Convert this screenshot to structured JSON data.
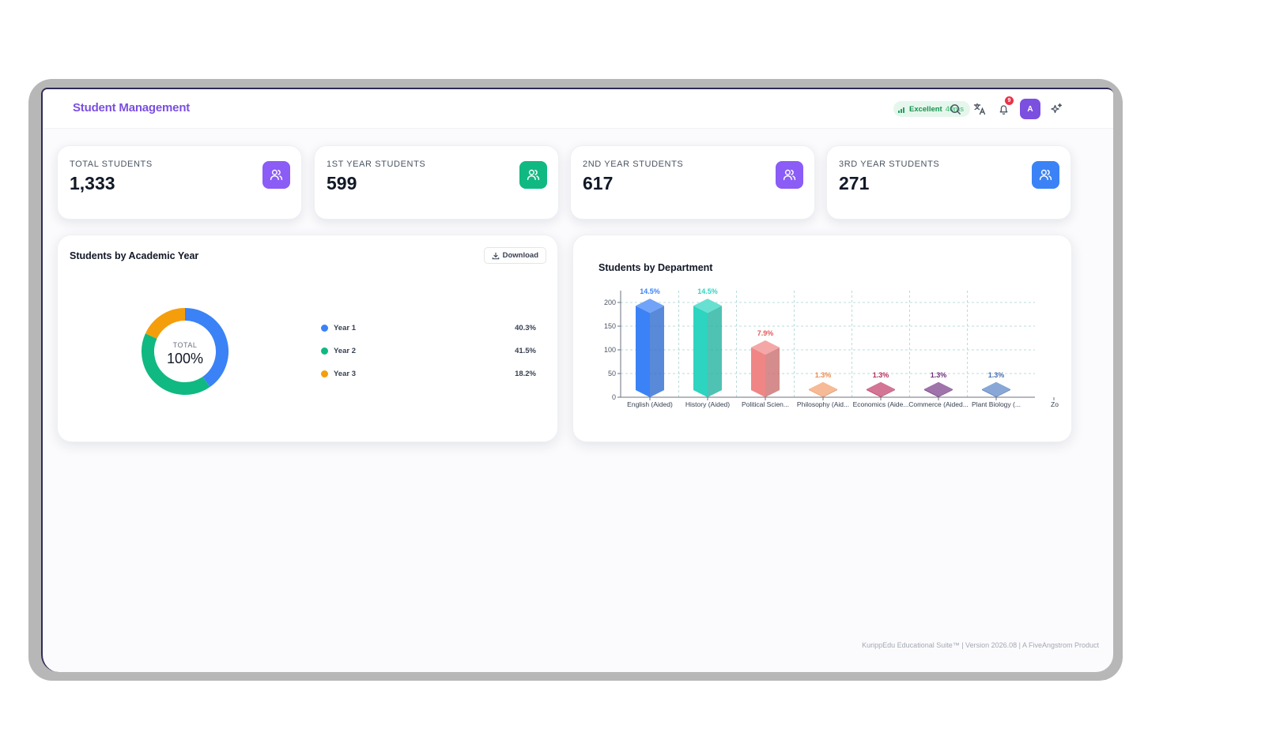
{
  "header": {
    "title": "Student Management",
    "status": {
      "quality": "Excellent",
      "latency": "40ms",
      "color": "#16924f"
    },
    "icons": [
      "search-icon",
      "translate-icon",
      "bell-icon",
      "sparkle-icon"
    ],
    "notification_count": "9",
    "avatar_initial": "A"
  },
  "stats": [
    {
      "label": "TOTAL STUDENTS",
      "value": "1,333",
      "icon": "users-icon",
      "color": "#8b5cf6"
    },
    {
      "label": "1ST YEAR STUDENTS",
      "value": "599",
      "icon": "users-icon",
      "color": "#10b981"
    },
    {
      "label": "2ND YEAR STUDENTS",
      "value": "617",
      "icon": "users-icon",
      "color": "#8b5cf6"
    },
    {
      "label": "3RD YEAR STUDENTS",
      "value": "271",
      "icon": "users-icon",
      "color": "#3b82f6"
    }
  ],
  "academic_panel": {
    "title": "Students by Academic Year",
    "download_label": "Download",
    "center_label": "TOTAL",
    "center_value": "100%"
  },
  "department_panel": {
    "title": "Students by Department"
  },
  "footer": {
    "text": "KurippEdu Educational Suite™ | Version 2026.08 | A FiveAngstrom Product"
  },
  "chart_data": [
    {
      "type": "pie",
      "categories": [
        "Year 1",
        "Year 2",
        "Year 3"
      ],
      "values": [
        40.3,
        41.5,
        18.2
      ],
      "value_labels": [
        "40.3%",
        "41.5%",
        "18.2%"
      ],
      "colors": [
        "#3b82f6",
        "#10b981",
        "#f59e0b"
      ],
      "donut": true,
      "legend": "right"
    },
    {
      "type": "bar",
      "title": "",
      "categories": [
        "English (Aided)",
        "History (Aided)",
        "Political Scien...",
        "Philosophy (Aid...",
        "Economics (Aide...",
        "Commerce (Aided...",
        "Plant Biology (...",
        "Zo"
      ],
      "values": [
        193,
        193,
        105,
        17,
        17,
        17,
        17,
        null
      ],
      "value_labels": [
        "14.5%",
        "14.5%",
        "7.9%",
        "1.3%",
        "1.3%",
        "1.3%",
        "1.3%",
        ""
      ],
      "colors": [
        "#3b82f6",
        "#2dd4bf",
        "#f08585",
        "#f4a06e",
        "#c2416b",
        "#7b3f8a",
        "#5b85c7",
        "#999999"
      ],
      "label_colors": [
        "#3b82f6",
        "#2dd4bf",
        "#e05a5a",
        "#ee8a4f",
        "#b22d57",
        "#6d2e7c",
        "#4a6fae",
        "#999999"
      ],
      "yticks": [
        0,
        50,
        100,
        150,
        200
      ],
      "ylim": [
        0,
        210
      ],
      "grid": true
    }
  ]
}
